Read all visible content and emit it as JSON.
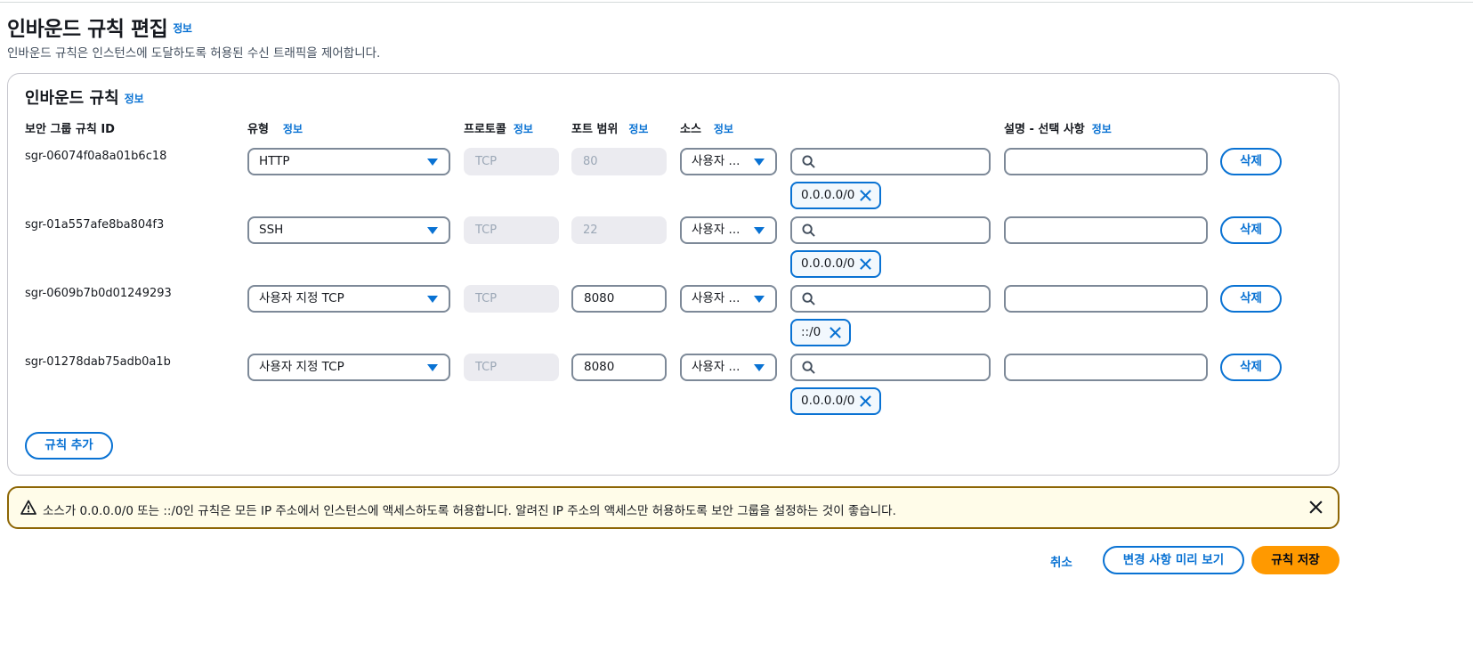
{
  "header": {
    "title": "인바운드 규칙 편집",
    "info": "정보",
    "description": "인바운드 규칙은 인스턴스에 도달하도록 허용된 수신 트래픽을 제어합니다."
  },
  "panel": {
    "title": "인바운드 규칙",
    "info": "정보",
    "columns": {
      "rule_id": "보안 그룹 규칙 ID",
      "type": "유형",
      "protocol": "프로토콜",
      "port_range": "포트 범위",
      "source": "소스",
      "description": "설명 - 선택 사항",
      "info": "정보"
    },
    "rules": [
      {
        "id": "sgr-06074f0a8a01b6c18",
        "type": "HTTP",
        "protocol": "TCP",
        "port": "80",
        "port_editable": false,
        "source": "사용자 ...",
        "search_value": "",
        "cidr": "0.0.0.0/0",
        "description": "",
        "delete_label": "삭제"
      },
      {
        "id": "sgr-01a557afe8ba804f3",
        "type": "SSH",
        "protocol": "TCP",
        "port": "22",
        "port_editable": false,
        "source": "사용자 ...",
        "search_value": "",
        "cidr": "0.0.0.0/0",
        "description": "",
        "delete_label": "삭제"
      },
      {
        "id": "sgr-0609b7b0d01249293",
        "type": "사용자 지정 TCP",
        "protocol": "TCP",
        "port": "8080",
        "port_editable": true,
        "source": "사용자 ...",
        "search_value": "",
        "cidr": "::/0",
        "description": "",
        "delete_label": "삭제"
      },
      {
        "id": "sgr-01278dab75adb0a1b",
        "type": "사용자 지정 TCP",
        "protocol": "TCP",
        "port": "8080",
        "port_editable": true,
        "source": "사용자 ...",
        "search_value": "",
        "cidr": "0.0.0.0/0",
        "description": "",
        "delete_label": "삭제"
      }
    ],
    "add_rule_label": "규칙 추가"
  },
  "alert": {
    "text": "소스가 0.0.0.0/0 또는 ::/0인 규칙은 모든 IP 주소에서 인스턴스에 액세스하도록 허용합니다. 알려진 IP 주소의 액세스만 허용하도록 보안 그룹을 설정하는 것이 좋습니다."
  },
  "footer": {
    "cancel_label": "취소",
    "preview_label": "변경 사항 미리 보기",
    "save_label": "규칙 저장"
  },
  "colors": {
    "link": "#0972d3",
    "primary": "#ff9900",
    "warning_border": "#8d6605",
    "warning_bg": "#fffce9"
  }
}
